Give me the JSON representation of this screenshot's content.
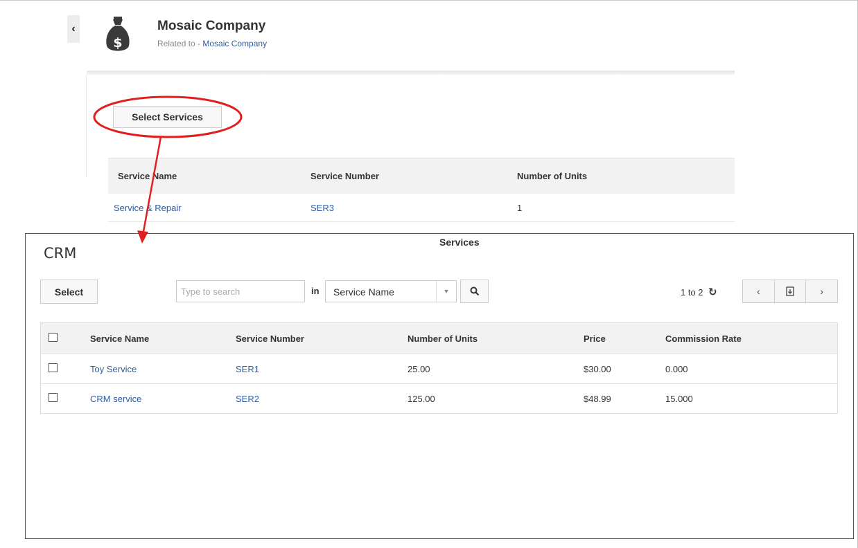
{
  "record": {
    "title": "Mosaic Company",
    "related_prefix": "Related to - ",
    "related_link": "Mosaic Company"
  },
  "actions": {
    "select_services_label": "Select Services"
  },
  "related_services": {
    "columns": [
      "Service Name",
      "Service Number",
      "Number of Units"
    ],
    "rows": [
      {
        "name": "Service & Repair",
        "number": "SER3",
        "units": "1"
      }
    ]
  },
  "modal": {
    "logo": "CRM",
    "title": "Services",
    "select_label": "Select",
    "search_placeholder": "Type to search",
    "in_label": "in",
    "search_field": "Service Name",
    "count": "1 to 2",
    "columns": [
      "Service Name",
      "Service Number",
      "Number of Units",
      "Price",
      "Commission Rate"
    ],
    "rows": [
      {
        "name": "Toy Service",
        "number": "SER1",
        "units": "25.00",
        "price": "$30.00",
        "rate": "0.000"
      },
      {
        "name": "CRM service",
        "number": "SER2",
        "units": "125.00",
        "price": "$48.99",
        "rate": "15.000"
      }
    ]
  },
  "icons": {
    "back": "chevron-left-icon",
    "record": "money-bag-icon",
    "search": "search-icon",
    "refresh": "refresh-icon",
    "prev": "chevron-left-icon",
    "export": "export-icon",
    "next": "chevron-right-icon"
  },
  "colors": {
    "link": "#2e5c9e",
    "annotation": "#e02020",
    "icon_dark": "#3a3a3a"
  }
}
